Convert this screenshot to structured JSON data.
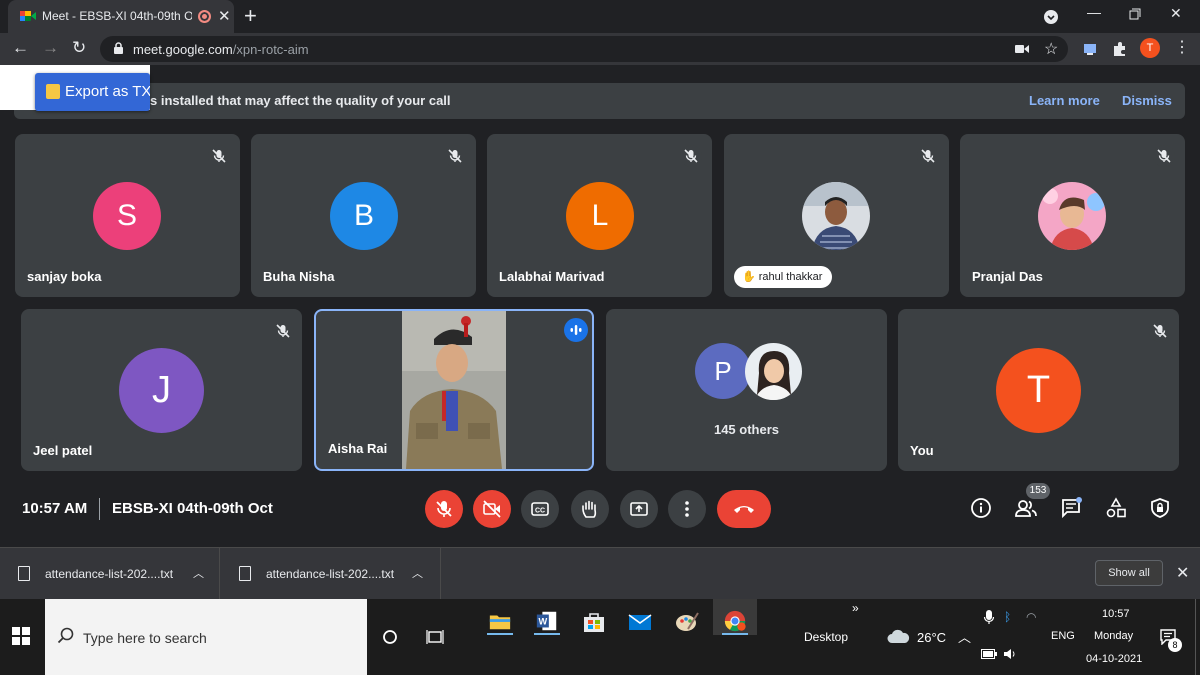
{
  "browser": {
    "tab_title": "Meet - EBSB-XI 04th-09th Oc",
    "url_host": "meet.google.com",
    "url_path": "/xpn-rotc-aim",
    "profile_initial": "T"
  },
  "banner": {
    "export_label": "Export as TX",
    "message": "s installed that may affect the quality of your call",
    "learn_more": "Learn more",
    "dismiss": "Dismiss"
  },
  "tiles": {
    "sanjay": {
      "name": "sanjay boka",
      "initial": "S",
      "color": "#ec407a"
    },
    "buha": {
      "name": "Buha Nisha",
      "initial": "B",
      "color": "#1e88e5"
    },
    "lalabhai": {
      "name": "Lalabhai Marivad",
      "initial": "L",
      "color": "#ef6c00"
    },
    "rahul": {
      "name": "rahul thakkar"
    },
    "pranjal": {
      "name": "Pranjal Das"
    },
    "jeel": {
      "name": "Jeel patel",
      "initial": "J",
      "color": "#7e57c2"
    },
    "aisha": {
      "name": "Aisha Rai"
    },
    "others": {
      "label": "145 others",
      "initial": "P",
      "color": "#5c6bc0"
    },
    "you": {
      "name": "You",
      "initial": "T",
      "color": "#f4511e"
    }
  },
  "meeting": {
    "time": "10:57 AM",
    "title": "EBSB-XI 04th-09th Oct",
    "participant_count": "153"
  },
  "downloads": {
    "items": [
      {
        "filename": "attendance-list-202....txt"
      },
      {
        "filename": "attendance-list-202....txt"
      }
    ],
    "show_all": "Show all"
  },
  "taskbar": {
    "search_placeholder": "Type here to search",
    "desktop_label": "Desktop",
    "weather": "26°C",
    "language": "ENG",
    "time": "10:57",
    "day": "Monday",
    "date": "04-10-2021",
    "notification_count": "8"
  }
}
